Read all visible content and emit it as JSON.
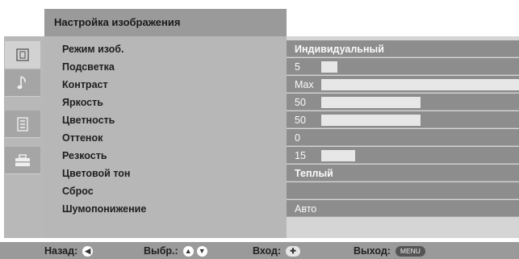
{
  "menu": {
    "title": "Настройка изображения"
  },
  "icons": [
    {
      "name": "picture-icon",
      "active": true
    },
    {
      "name": "sound-note-icon",
      "active": false
    },
    {
      "name": "settings-list-icon",
      "active": false
    },
    {
      "name": "toolbox-icon",
      "active": false
    }
  ],
  "settings": [
    {
      "label": "Режим изоб.",
      "value": "Индивидуальный",
      "bold": true
    },
    {
      "label": "Подсветка",
      "value": "5",
      "level": 0.08
    },
    {
      "label": "Контраст",
      "value": "Max",
      "level": 1.0
    },
    {
      "label": "Яркость",
      "value": "50",
      "level": 0.5
    },
    {
      "label": "Цветность",
      "value": "50",
      "level": 0.5
    },
    {
      "label": "Оттенок",
      "value": "0"
    },
    {
      "label": "Резкость",
      "value": "15",
      "level": 0.17
    },
    {
      "label": "Цветовой тон",
      "value": "Теплый",
      "bold": true
    },
    {
      "label": "Сброс",
      "value": ""
    },
    {
      "label": "Шумопонижение",
      "value": "Авто"
    }
  ],
  "footer": {
    "back_label": "Назад:",
    "select_label": "Выбр.:",
    "enter_label": "Вход:",
    "exit_label": "Выход:",
    "menu_key": "MENU"
  },
  "colors": {
    "title_bar": "#9a9a9a",
    "panel": "#b7b7b7",
    "value_row": "#8d8d8d",
    "slider": "#e7e7e7"
  }
}
